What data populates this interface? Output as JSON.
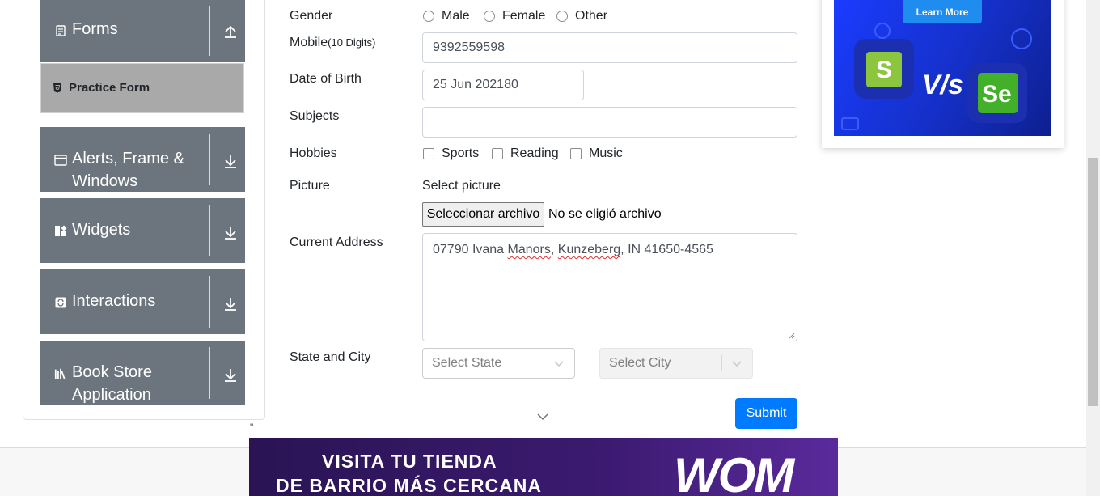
{
  "sidebar": {
    "groups": [
      {
        "label": "Forms",
        "icon": "document-icon"
      },
      {
        "label": "Alerts, Frame & Windows",
        "icon": "window-icon"
      },
      {
        "label": "Widgets",
        "icon": "widgets-icon"
      },
      {
        "label": "Interactions",
        "icon": "interactions-icon"
      },
      {
        "label": "Book Store Application",
        "icon": "books-icon"
      }
    ],
    "active_item": "Practice Form"
  },
  "form": {
    "gender": {
      "label": "Gender",
      "options": [
        "Male",
        "Female",
        "Other"
      ]
    },
    "mobile": {
      "label": "Mobile",
      "hint": "(10 Digits)",
      "value": "9392559598"
    },
    "dob": {
      "label": "Date of Birth",
      "value": "25 Jun 202180"
    },
    "subjects": {
      "label": "Subjects",
      "value": ""
    },
    "hobbies": {
      "label": "Hobbies",
      "options": [
        "Sports",
        "Reading",
        "Music"
      ]
    },
    "picture": {
      "label": "Picture",
      "select_text": "Select picture",
      "button": "Seleccionar archivo",
      "status": "No se eligió archivo"
    },
    "address": {
      "label": "Current Address",
      "value_part1": "07790 Ivana ",
      "value_word1": "Manors",
      "value_part2": ", ",
      "value_word2": "Kunzeberg",
      "value_part3": ", IN 41650-4565"
    },
    "state_city": {
      "label": "State and City",
      "state_placeholder": "Select State",
      "city_placeholder": "Select City"
    },
    "submit": "Submit"
  },
  "ad_top": {
    "learn_more": "Learn More",
    "vs": "V/s",
    "left_logo": "S",
    "right_logo": "Se"
  },
  "stray_quote": "\"",
  "banner": {
    "line1": "VISITA TU TIENDA",
    "line2": "DE BARRIO MÁS CERCANA",
    "brand": "WOM"
  },
  "colors": {
    "sidebar_group": "#6c757d",
    "active_item": "#a9a9a9",
    "submit": "#007bff"
  }
}
